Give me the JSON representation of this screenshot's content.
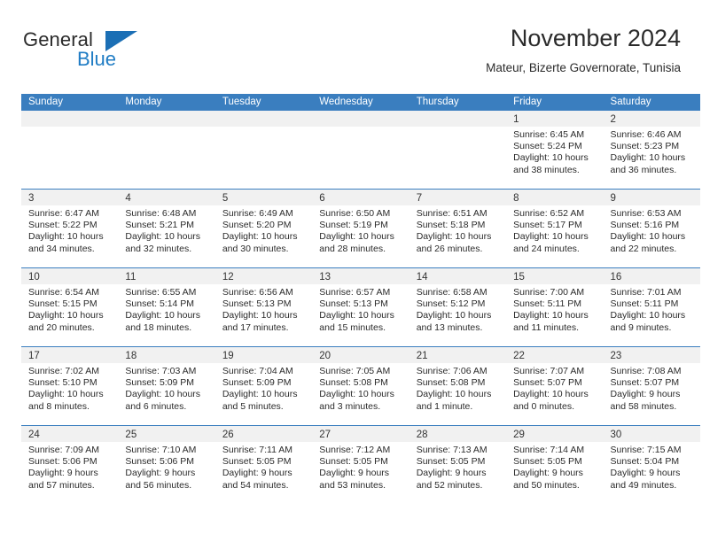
{
  "brand": {
    "name_part1": "General",
    "name_part2": "Blue",
    "triangle_icon": "blue-triangle-icon",
    "colors": {
      "general": "#2b2b2b",
      "blue": "#1f7cc4",
      "triangle": "#1b6fb5"
    }
  },
  "header": {
    "title": "November 2024",
    "subtitle": "Mateur, Bizerte Governorate, Tunisia"
  },
  "calendar": {
    "accent_color": "#3a7ebf",
    "daynum_band_color": "#f1f1f1",
    "weekday_headers": [
      "Sunday",
      "Monday",
      "Tuesday",
      "Wednesday",
      "Thursday",
      "Friday",
      "Saturday"
    ],
    "weeks": [
      [
        {
          "day": "",
          "empty": true,
          "lines": []
        },
        {
          "day": "",
          "empty": true,
          "lines": []
        },
        {
          "day": "",
          "empty": true,
          "lines": []
        },
        {
          "day": "",
          "empty": true,
          "lines": []
        },
        {
          "day": "",
          "empty": true,
          "lines": []
        },
        {
          "day": "1",
          "empty": false,
          "lines": [
            "Sunrise: 6:45 AM",
            "Sunset: 5:24 PM",
            "Daylight: 10 hours",
            "and 38 minutes."
          ]
        },
        {
          "day": "2",
          "empty": false,
          "lines": [
            "Sunrise: 6:46 AM",
            "Sunset: 5:23 PM",
            "Daylight: 10 hours",
            "and 36 minutes."
          ]
        }
      ],
      [
        {
          "day": "3",
          "empty": false,
          "lines": [
            "Sunrise: 6:47 AM",
            "Sunset: 5:22 PM",
            "Daylight: 10 hours",
            "and 34 minutes."
          ]
        },
        {
          "day": "4",
          "empty": false,
          "lines": [
            "Sunrise: 6:48 AM",
            "Sunset: 5:21 PM",
            "Daylight: 10 hours",
            "and 32 minutes."
          ]
        },
        {
          "day": "5",
          "empty": false,
          "lines": [
            "Sunrise: 6:49 AM",
            "Sunset: 5:20 PM",
            "Daylight: 10 hours",
            "and 30 minutes."
          ]
        },
        {
          "day": "6",
          "empty": false,
          "lines": [
            "Sunrise: 6:50 AM",
            "Sunset: 5:19 PM",
            "Daylight: 10 hours",
            "and 28 minutes."
          ]
        },
        {
          "day": "7",
          "empty": false,
          "lines": [
            "Sunrise: 6:51 AM",
            "Sunset: 5:18 PM",
            "Daylight: 10 hours",
            "and 26 minutes."
          ]
        },
        {
          "day": "8",
          "empty": false,
          "lines": [
            "Sunrise: 6:52 AM",
            "Sunset: 5:17 PM",
            "Daylight: 10 hours",
            "and 24 minutes."
          ]
        },
        {
          "day": "9",
          "empty": false,
          "lines": [
            "Sunrise: 6:53 AM",
            "Sunset: 5:16 PM",
            "Daylight: 10 hours",
            "and 22 minutes."
          ]
        }
      ],
      [
        {
          "day": "10",
          "empty": false,
          "lines": [
            "Sunrise: 6:54 AM",
            "Sunset: 5:15 PM",
            "Daylight: 10 hours",
            "and 20 minutes."
          ]
        },
        {
          "day": "11",
          "empty": false,
          "lines": [
            "Sunrise: 6:55 AM",
            "Sunset: 5:14 PM",
            "Daylight: 10 hours",
            "and 18 minutes."
          ]
        },
        {
          "day": "12",
          "empty": false,
          "lines": [
            "Sunrise: 6:56 AM",
            "Sunset: 5:13 PM",
            "Daylight: 10 hours",
            "and 17 minutes."
          ]
        },
        {
          "day": "13",
          "empty": false,
          "lines": [
            "Sunrise: 6:57 AM",
            "Sunset: 5:13 PM",
            "Daylight: 10 hours",
            "and 15 minutes."
          ]
        },
        {
          "day": "14",
          "empty": false,
          "lines": [
            "Sunrise: 6:58 AM",
            "Sunset: 5:12 PM",
            "Daylight: 10 hours",
            "and 13 minutes."
          ]
        },
        {
          "day": "15",
          "empty": false,
          "lines": [
            "Sunrise: 7:00 AM",
            "Sunset: 5:11 PM",
            "Daylight: 10 hours",
            "and 11 minutes."
          ]
        },
        {
          "day": "16",
          "empty": false,
          "lines": [
            "Sunrise: 7:01 AM",
            "Sunset: 5:11 PM",
            "Daylight: 10 hours",
            "and 9 minutes."
          ]
        }
      ],
      [
        {
          "day": "17",
          "empty": false,
          "lines": [
            "Sunrise: 7:02 AM",
            "Sunset: 5:10 PM",
            "Daylight: 10 hours",
            "and 8 minutes."
          ]
        },
        {
          "day": "18",
          "empty": false,
          "lines": [
            "Sunrise: 7:03 AM",
            "Sunset: 5:09 PM",
            "Daylight: 10 hours",
            "and 6 minutes."
          ]
        },
        {
          "day": "19",
          "empty": false,
          "lines": [
            "Sunrise: 7:04 AM",
            "Sunset: 5:09 PM",
            "Daylight: 10 hours",
            "and 5 minutes."
          ]
        },
        {
          "day": "20",
          "empty": false,
          "lines": [
            "Sunrise: 7:05 AM",
            "Sunset: 5:08 PM",
            "Daylight: 10 hours",
            "and 3 minutes."
          ]
        },
        {
          "day": "21",
          "empty": false,
          "lines": [
            "Sunrise: 7:06 AM",
            "Sunset: 5:08 PM",
            "Daylight: 10 hours",
            "and 1 minute."
          ]
        },
        {
          "day": "22",
          "empty": false,
          "lines": [
            "Sunrise: 7:07 AM",
            "Sunset: 5:07 PM",
            "Daylight: 10 hours",
            "and 0 minutes."
          ]
        },
        {
          "day": "23",
          "empty": false,
          "lines": [
            "Sunrise: 7:08 AM",
            "Sunset: 5:07 PM",
            "Daylight: 9 hours",
            "and 58 minutes."
          ]
        }
      ],
      [
        {
          "day": "24",
          "empty": false,
          "lines": [
            "Sunrise: 7:09 AM",
            "Sunset: 5:06 PM",
            "Daylight: 9 hours",
            "and 57 minutes."
          ]
        },
        {
          "day": "25",
          "empty": false,
          "lines": [
            "Sunrise: 7:10 AM",
            "Sunset: 5:06 PM",
            "Daylight: 9 hours",
            "and 56 minutes."
          ]
        },
        {
          "day": "26",
          "empty": false,
          "lines": [
            "Sunrise: 7:11 AM",
            "Sunset: 5:05 PM",
            "Daylight: 9 hours",
            "and 54 minutes."
          ]
        },
        {
          "day": "27",
          "empty": false,
          "lines": [
            "Sunrise: 7:12 AM",
            "Sunset: 5:05 PM",
            "Daylight: 9 hours",
            "and 53 minutes."
          ]
        },
        {
          "day": "28",
          "empty": false,
          "lines": [
            "Sunrise: 7:13 AM",
            "Sunset: 5:05 PM",
            "Daylight: 9 hours",
            "and 52 minutes."
          ]
        },
        {
          "day": "29",
          "empty": false,
          "lines": [
            "Sunrise: 7:14 AM",
            "Sunset: 5:05 PM",
            "Daylight: 9 hours",
            "and 50 minutes."
          ]
        },
        {
          "day": "30",
          "empty": false,
          "lines": [
            "Sunrise: 7:15 AM",
            "Sunset: 5:04 PM",
            "Daylight: 9 hours",
            "and 49 minutes."
          ]
        }
      ]
    ]
  }
}
